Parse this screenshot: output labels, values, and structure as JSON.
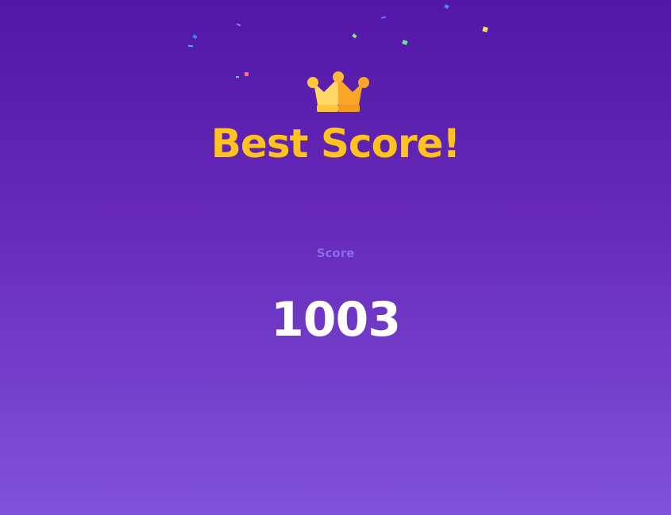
{
  "title": "Best Score!",
  "score_label": "Score",
  "score_value": "1003",
  "icons": {
    "crown": "crown-icon",
    "confetti": "confetti-decoration"
  },
  "colors": {
    "background_top": "#5217a8",
    "background_bottom": "#8152da",
    "title": "#ffc21f",
    "label": "#8f6ae6",
    "score": "#ffffff",
    "crown_light": "#ffd766",
    "crown_dark": "#f9a526"
  }
}
